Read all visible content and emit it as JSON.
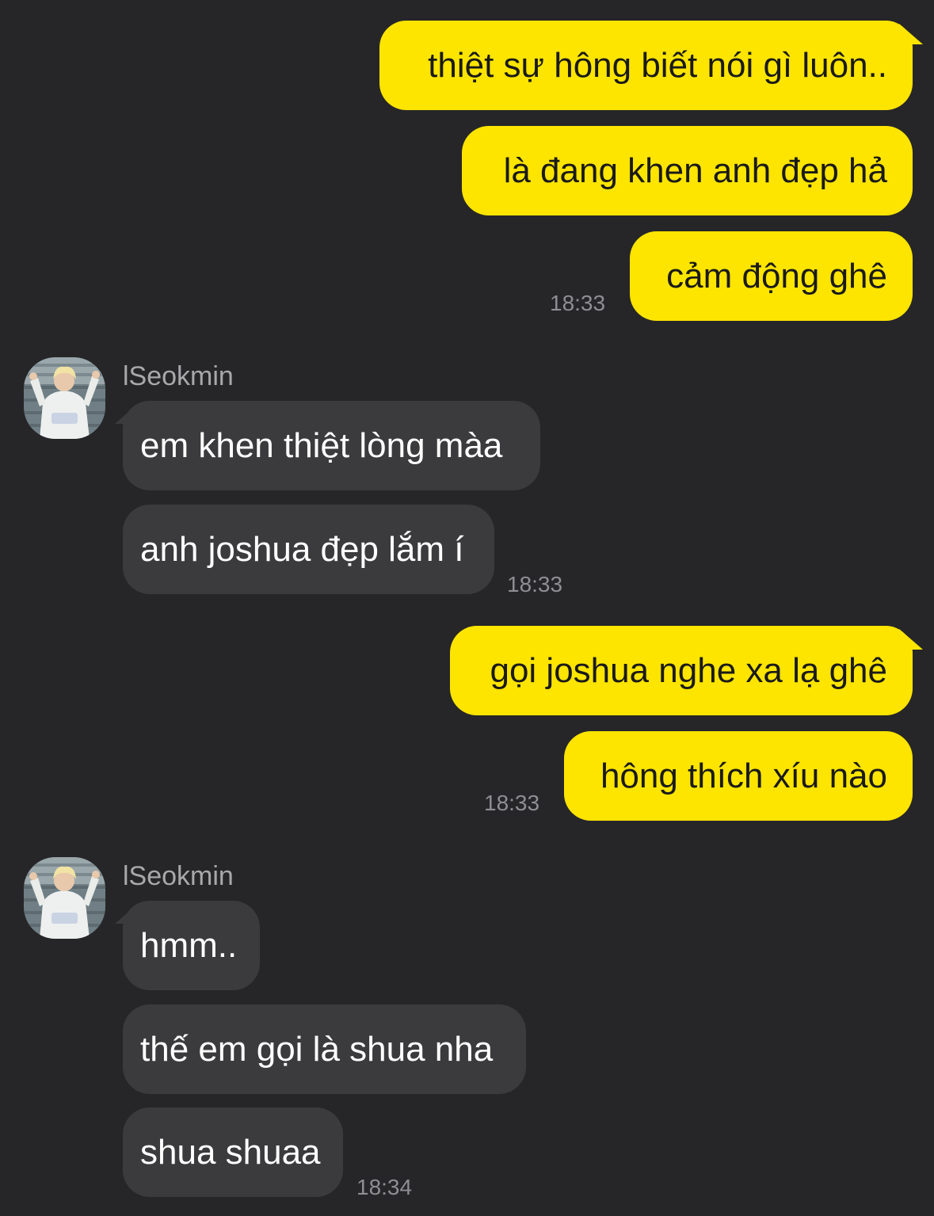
{
  "colors": {
    "background": "#262628",
    "sent_bubble": "#FEE500",
    "received_bubble": "#3b3b3d",
    "timestamp": "#8e8e93",
    "sender_name": "#a8a8ab"
  },
  "messages": [
    {
      "text": "thiệt sự hông biết nói gì luôn.."
    },
    {
      "text": "là đang khen anh đẹp hả"
    },
    {
      "text": "cảm động ghê"
    },
    {
      "text": "em khen thiệt lòng màa"
    },
    {
      "text": "anh joshua đẹp lắm í"
    },
    {
      "text": "gọi joshua nghe xa lạ ghê"
    },
    {
      "text": "hông thích xíu nào"
    },
    {
      "text": "hmm.."
    },
    {
      "text": "thế em gọi là shua nha"
    },
    {
      "text": "shua shuaa"
    }
  ],
  "timestamps": [
    "18:33",
    "18:33",
    "18:33",
    "18:34"
  ],
  "senders": [
    {
      "name": "lSeokmin",
      "avatar_icon": "profile-photo-avatar"
    },
    {
      "name": "lSeokmin",
      "avatar_icon": "profile-photo-avatar"
    }
  ]
}
